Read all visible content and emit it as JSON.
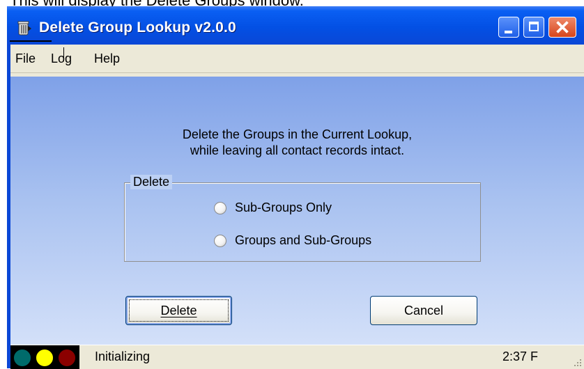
{
  "caption": "This will display the Delete Groups window.",
  "window": {
    "title": "Delete Group Lookup v2.0.0",
    "controls": {
      "minimize": "minimize-icon",
      "maximize": "maximize-icon",
      "close": "close-icon"
    }
  },
  "menu": {
    "items": [
      {
        "label": "File"
      },
      {
        "label": "Log"
      },
      {
        "label": "Help"
      }
    ]
  },
  "content": {
    "message_line1": "Delete the Groups in the Current Lookup,",
    "message_line2": "while leaving all contact records intact.",
    "group_title": "Delete",
    "options": [
      {
        "label": "Sub-Groups Only",
        "selected": false
      },
      {
        "label": "Groups and Sub-Groups",
        "selected": false
      }
    ]
  },
  "buttons": {
    "delete_label": "Delete",
    "cancel_label": "Cancel"
  },
  "status": {
    "lights": [
      "#006b6b",
      "#ffff00",
      "#8b0000"
    ],
    "text": "Initializing",
    "time": "2:37 F"
  }
}
